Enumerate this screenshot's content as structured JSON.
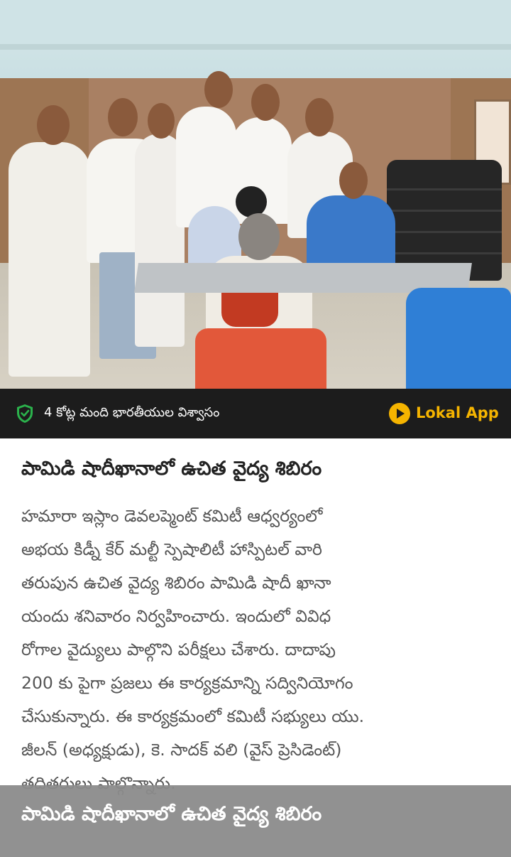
{
  "photo": {
    "description_icon": "news-photo"
  },
  "brand_bar": {
    "trust_icon": "shield-check-icon",
    "trust_text": "4 కోట్ల మంది భారతీయుల విశ్వాసం",
    "logo_icon": "play-circle-icon",
    "app_name": "Lokal App",
    "accent_color": "#f5b400",
    "shield_color": "#2bb24c"
  },
  "article": {
    "title": "పామిడి షాదీఖానాలో ఉచిత వైద్య శిబిరం",
    "body": "హమారా ఇస్లాం డెవలప్మెంట్ కమిటీ ఆధ్వర్యంలో\nఅభయ కిడ్నీ కేర్ మల్టీ స్పెషాలిటీ హాస్పిటల్ వారి\nతరుపున ఉచిత వైద్య శిబిరం పామిడి షాదీ ఖానా\nయందు శనివారం నిర్వహించారు. ఇందులో వివిధ\nరోగాల వైద్యులు పాల్గొని పరీక్షలు చేశారు. దాదాపు\n200 కు పైగా ప్రజలు ఈ కార్యక్రమాన్ని సద్వినియోగం\nచేసుకున్నారు. ఈ కార్యక్రమంలో కమిటీ సభ్యులు యు.\nజీలన్ (అధ్యక్షుడు), కె. సాదక్ వలి (వైస్ ప్రెసిడెంట్)\nతదితరులు పాల్గొన్నారు."
  },
  "overlay": {
    "caption": "పామిడి షాదీఖానాలో ఉచిత వైద్య శిబిరం"
  }
}
